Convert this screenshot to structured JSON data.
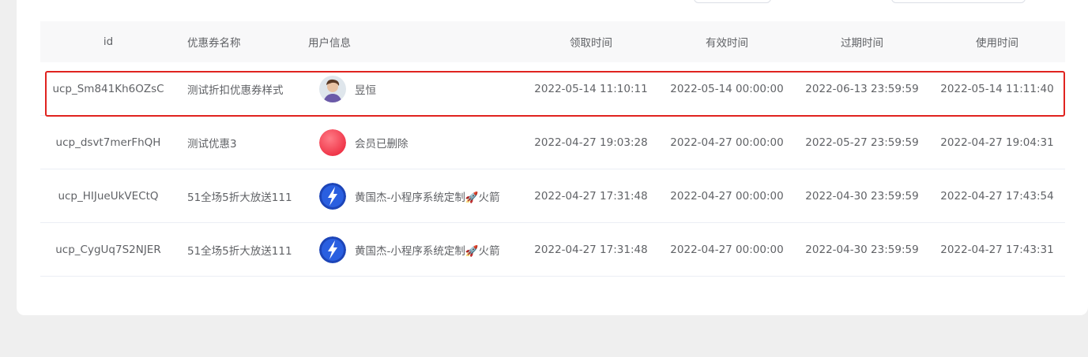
{
  "table": {
    "headers": [
      "id",
      "优惠券名称",
      "用户信息",
      "领取时间",
      "有效时间",
      "过期时间",
      "使用时间"
    ],
    "rows": [
      {
        "id": "ucp_Sm841Kh6OZsC",
        "name": "测试折扣优惠券样式",
        "avatar": "person-avatar",
        "user": "昱恒",
        "received": "2022-05-14 11:10:11",
        "valid": "2022-05-14 00:00:00",
        "expire": "2022-06-13 23:59:59",
        "used": "2022-05-14 11:11:40"
      },
      {
        "id": "ucp_dsvt7merFhQH",
        "name": "测试优惠3",
        "avatar": "red-circle-avatar",
        "user": "会员已删除",
        "received": "2022-04-27 19:03:28",
        "valid": "2022-04-27 00:00:00",
        "expire": "2022-05-27 23:59:59",
        "used": "2022-04-27 19:04:31"
      },
      {
        "id": "ucp_HIJueUkVECtQ",
        "name": "51全场5折大放送111",
        "avatar": "lightning-avatar",
        "user": "黄国杰-小程序系统定制🚀火箭",
        "received": "2022-04-27 17:31:48",
        "valid": "2022-04-27 00:00:00",
        "expire": "2022-04-30 23:59:59",
        "used": "2022-04-27 17:43:54"
      },
      {
        "id": "ucp_CygUq7S2NJER",
        "name": "51全场5折大放送111",
        "avatar": "lightning-avatar",
        "user": "黄国杰-小程序系统定制🚀火箭",
        "received": "2022-04-27 17:31:48",
        "valid": "2022-04-27 00:00:00",
        "expire": "2022-04-30 23:59:59",
        "used": "2022-04-27 17:43:31"
      }
    ]
  },
  "colors": {
    "highlight": "#e0231f",
    "header_bg": "#f8f8f9",
    "page_bg": "#efefef"
  }
}
